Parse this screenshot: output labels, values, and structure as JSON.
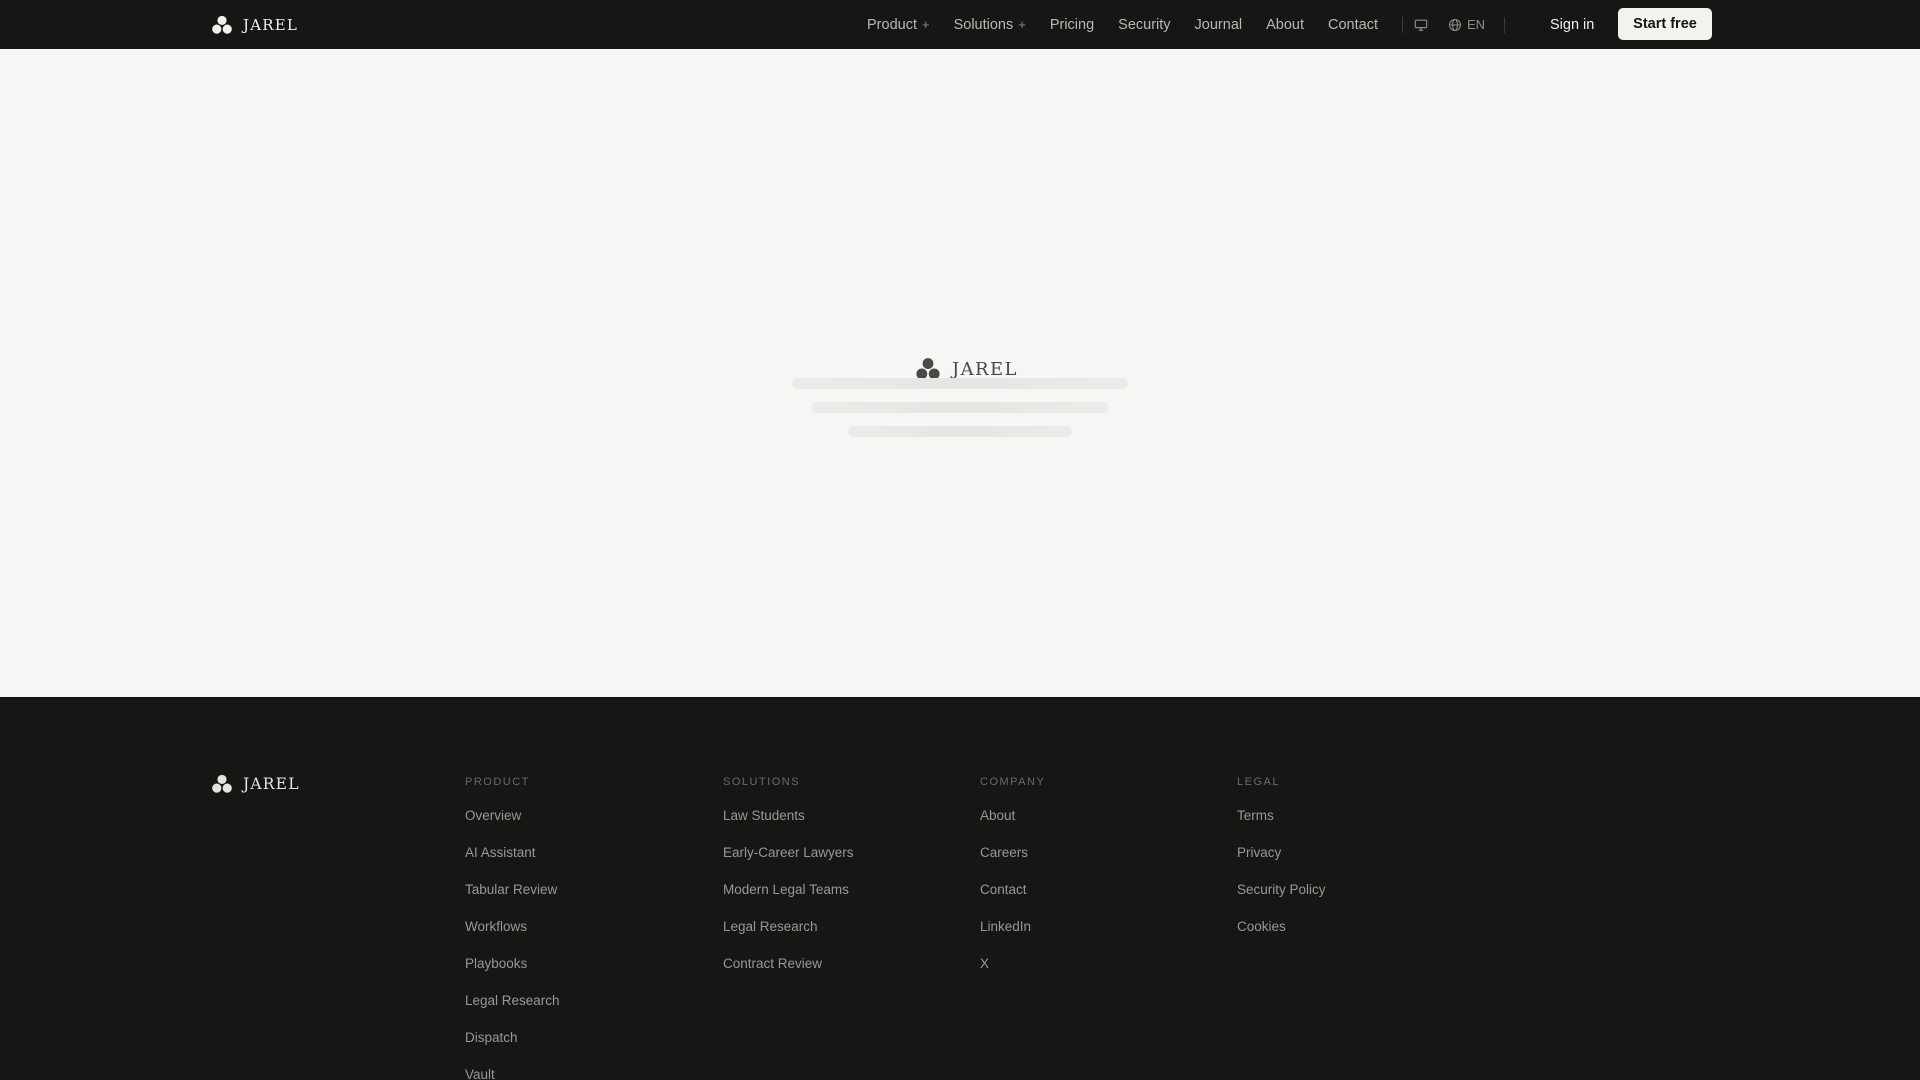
{
  "brand": {
    "name": "JAREL"
  },
  "nav": {
    "items": [
      {
        "label": "Product",
        "suffix": "+"
      },
      {
        "label": "Solutions",
        "suffix": "+"
      },
      {
        "label": "Pricing"
      },
      {
        "label": "Security"
      },
      {
        "label": "Journal"
      },
      {
        "label": "About"
      },
      {
        "label": "Contact"
      }
    ],
    "language": "EN",
    "sign_in": "Sign in",
    "start_free": "Start free"
  },
  "footer": {
    "columns": [
      {
        "heading": "PRODUCT",
        "links": [
          "Overview",
          "AI Assistant",
          "Tabular Review",
          "Workflows",
          "Playbooks",
          "Legal Research",
          "Dispatch",
          "Vault"
        ]
      },
      {
        "heading": "SOLUTIONS",
        "links": [
          "Law Students",
          "Early-Career Lawyers",
          "Modern Legal Teams",
          "Legal Research",
          "Contract Review"
        ]
      },
      {
        "heading": "COMPANY",
        "links": [
          "About",
          "Careers",
          "Contact",
          "LinkedIn",
          "X"
        ]
      },
      {
        "heading": "LEGAL",
        "links": [
          "Terms",
          "Privacy",
          "Security Policy",
          "Cookies"
        ]
      }
    ]
  },
  "colors": {
    "dark": "#161614",
    "page": "#f6f6f4",
    "skeleton": "#ebebe8"
  }
}
